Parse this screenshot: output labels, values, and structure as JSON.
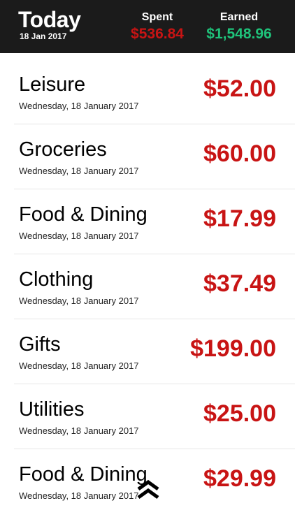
{
  "header": {
    "title": "Today",
    "date": "18 Jan 2017",
    "spent_label": "Spent",
    "spent_value": "$536.84",
    "earned_label": "Earned",
    "earned_value": "$1,548.96"
  },
  "transactions": [
    {
      "category": "Leisure",
      "date": "Wednesday, 18 January 2017",
      "amount": "$52.00"
    },
    {
      "category": "Groceries",
      "date": "Wednesday, 18 January 2017",
      "amount": "$60.00"
    },
    {
      "category": "Food & Dining",
      "date": "Wednesday, 18 January 2017",
      "amount": "$17.99"
    },
    {
      "category": "Clothing",
      "date": "Wednesday, 18 January 2017",
      "amount": "$37.49"
    },
    {
      "category": "Gifts",
      "date": "Wednesday, 18 January 2017",
      "amount": "$199.00"
    },
    {
      "category": "Utilities",
      "date": "Wednesday, 18 January 2017",
      "amount": "$25.00"
    },
    {
      "category": "Food & Dining",
      "date": "Wednesday, 18 January 2017",
      "amount": "$29.99"
    }
  ],
  "colors": {
    "header_bg": "#1b1b1b",
    "spent": "#c81414",
    "earned": "#1fc27a",
    "amount": "#c81414"
  },
  "icons": {
    "scroll_up": "double-chevron-up-icon"
  }
}
